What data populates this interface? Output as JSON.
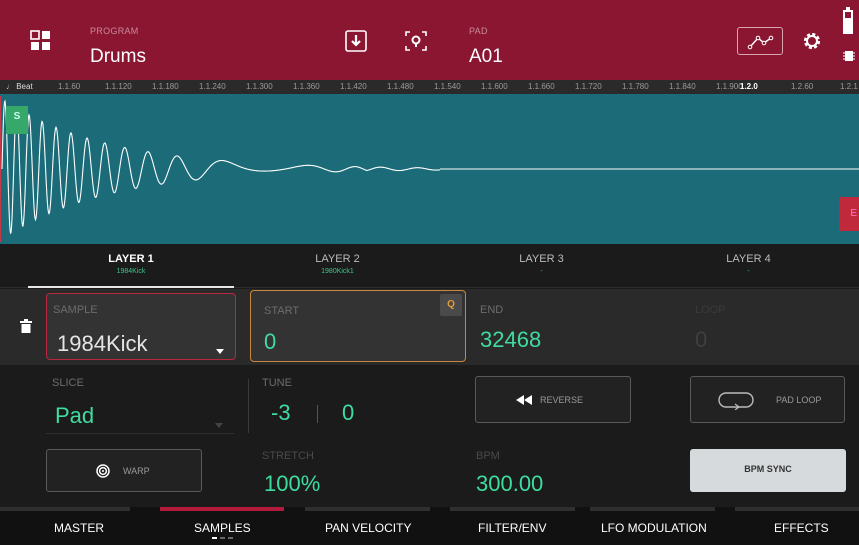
{
  "header": {
    "program_label": "PROGRAM",
    "program_name": "Drums",
    "pad_label": "PAD",
    "pad_name": "A01",
    "icons": [
      "grid-icon",
      "save-down-arrow-icon",
      "locate-icon",
      "envelope-icon",
      "gear-icon",
      "battery-icon",
      "chip-icon"
    ]
  },
  "ruler": {
    "unit_label": "♩ Beat",
    "ticks": [
      "1.1.60",
      "1.1.120",
      "1.1.180",
      "1.1.240",
      "1.1.300",
      "1.1.360",
      "1.1.420",
      "1.1.480",
      "1.1.540",
      "1.1.600",
      "1.1.660",
      "1.1.720",
      "1.1.780",
      "1.1.840",
      "1.1.900",
      "1.2.0",
      "1.2.60",
      "1.2.1"
    ]
  },
  "waveform": {
    "start_marker": "S",
    "end_marker": "E"
  },
  "layers": [
    {
      "title": "LAYER 1",
      "sample": "1984Kick",
      "active": true
    },
    {
      "title": "LAYER 2",
      "sample": "1980Kick1",
      "active": false
    },
    {
      "title": "LAYER 3",
      "sample": "-",
      "active": false
    },
    {
      "title": "LAYER 4",
      "sample": "-",
      "active": false
    }
  ],
  "params": {
    "sample_label": "SAMPLE",
    "sample_value": "1984Kick",
    "start_label": "START",
    "start_value": "0",
    "start_badge": "Q",
    "end_label": "END",
    "end_value": "32468",
    "loop_label": "LOOP",
    "loop_value": "0",
    "slice_label": "SLICE",
    "slice_value": "Pad",
    "tune_label": "TUNE",
    "tune_coarse": "-3",
    "tune_fine": "0",
    "reverse_label": "REVERSE",
    "pad_loop_label": "PAD LOOP",
    "warp_label": "WARP",
    "stretch_label": "STRETCH",
    "stretch_value": "100%",
    "bpm_label": "BPM",
    "bpm_value": "300.00",
    "bpm_sync_label": "BPM SYNC"
  },
  "tabs": [
    {
      "label": "MASTER",
      "active": false
    },
    {
      "label": "SAMPLES",
      "active": true
    },
    {
      "label": "PAN VELOCITY",
      "active": false
    },
    {
      "label": "FILTER/ENV",
      "active": false
    },
    {
      "label": "LFO MODULATION",
      "active": false
    },
    {
      "label": "EFFECTS",
      "active": false
    }
  ],
  "colors": {
    "header_bg": "#8a1632",
    "waveform_bg": "#1b6c78",
    "accent_green": "#3fdca0",
    "accent_red": "#b21b3c",
    "start_box_border": "#c8873a"
  }
}
